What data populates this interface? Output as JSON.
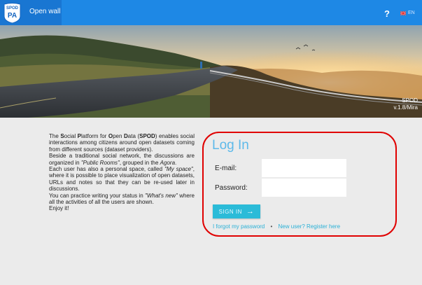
{
  "header": {
    "logo_text_top": "SPOD",
    "logo_text_bottom": "PA",
    "title": "Open wall",
    "help_label": "?",
    "language_code": "EN",
    "flag_icon": "uk-flag-icon",
    "accent_color": "#1e88e5"
  },
  "hero": {
    "app_name": "SPOD",
    "version": "v.1.8/Mira"
  },
  "about": {
    "paragraphs": [
      {
        "parts": [
          {
            "t": "The "
          },
          {
            "t": "S",
            "b": true
          },
          {
            "t": "ocial "
          },
          {
            "t": "P",
            "b": true
          },
          {
            "t": "latform for "
          },
          {
            "t": "O",
            "b": true
          },
          {
            "t": "pen "
          },
          {
            "t": "D",
            "b": true
          },
          {
            "t": "ata ("
          },
          {
            "t": "SPOD",
            "b": true
          },
          {
            "t": ") enables social interactions among citizens around open datasets coming from different sources (dataset providers)."
          }
        ]
      },
      {
        "parts": [
          {
            "t": "Beside a traditional social network, the discussions are organized in "
          },
          {
            "t": "\"Public Rooms\"",
            "i": true
          },
          {
            "t": ", grouped in the "
          },
          {
            "t": "Agora",
            "i": true
          },
          {
            "t": "."
          }
        ]
      },
      {
        "parts": [
          {
            "t": "Each user has also a personal space, called "
          },
          {
            "t": "\"My space\"",
            "i": true
          },
          {
            "t": ", where it is possible to place visualization of open datasets, URLs and notes so that they can be re-used later in discussions."
          }
        ]
      },
      {
        "parts": [
          {
            "t": "You can practice writing your status in "
          },
          {
            "t": "\"What's new\"",
            "i": true
          },
          {
            "t": " where all the activities of all the users are shown."
          }
        ]
      },
      {
        "parts": [
          {
            "t": "Enjoy it!"
          }
        ]
      }
    ]
  },
  "login": {
    "title": "Log In",
    "email_label": "E-mail:",
    "email_value": "",
    "password_label": "Password:",
    "password_value": "",
    "submit_label": "SIGN IN",
    "submit_icon": "arrow-right-icon",
    "forgot_label": "I forgot my password",
    "separator": "•",
    "register_label": "New user? Register here",
    "accent_color": "#2bbbd8"
  }
}
